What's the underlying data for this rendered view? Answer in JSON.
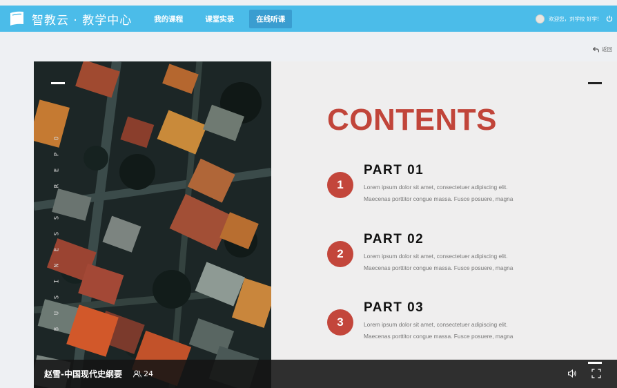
{
  "header": {
    "app_title": "智教云 · 教学中心",
    "nav": [
      {
        "label": "我的课程",
        "active": false
      },
      {
        "label": "课堂实录",
        "active": false
      },
      {
        "label": "在线听课",
        "active": true
      }
    ],
    "user_text": "欢迎您，刘学校 好学!",
    "accent_color": "#4bbce9"
  },
  "back_label": "返回",
  "slide": {
    "side_vertical_text": "BUSINESS REPO",
    "title": "CONTENTS",
    "title_color": "#c1453a",
    "parts": [
      {
        "number": "1",
        "title": "PART 01",
        "line1": "Lorem ipsum dolor sit amet, consectetuer adipiscing elit.",
        "line2": "Maecenas porttitor congue massa. Fusce posuere, magna"
      },
      {
        "number": "2",
        "title": "PART 02",
        "line1": "Lorem ipsum dolor sit amet, consectetuer adipiscing elit.",
        "line2": "Maecenas porttitor congue massa. Fusce posuere, magna"
      },
      {
        "number": "3",
        "title": "PART 03",
        "line1": "Lorem ipsum dolor sit amet, consectetuer adipiscing elit.",
        "line2": "Maecenas porttitor congue massa. Fusce posuere, magna"
      }
    ]
  },
  "player": {
    "course_title": "赵雪-中国现代史纲要",
    "viewer_count": "24",
    "icons": [
      "users-icon",
      "volume-icon",
      "fullscreen-icon"
    ]
  }
}
